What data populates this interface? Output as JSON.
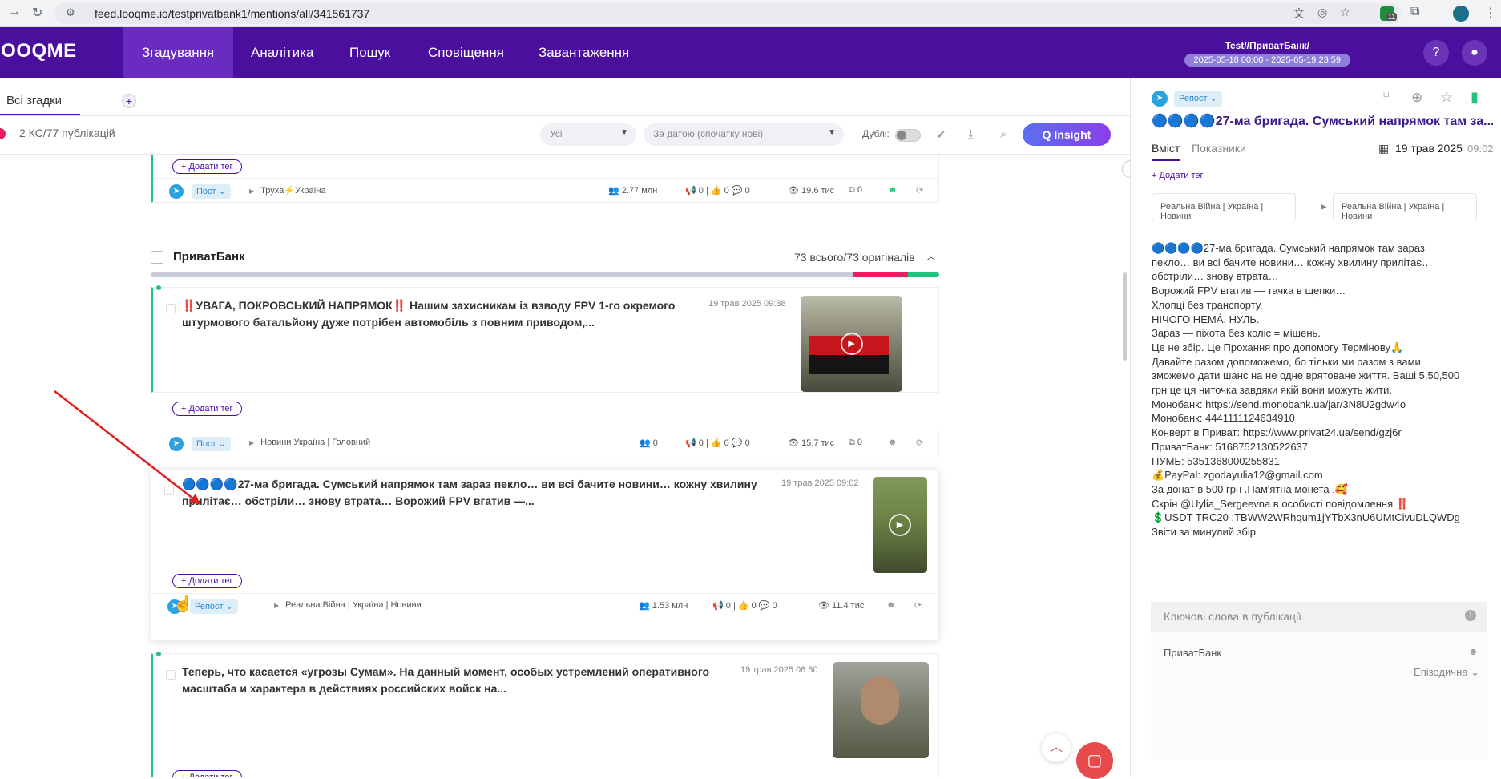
{
  "browser": {
    "url": "feed.looqme.io/testprivatbank1/mentions/all/341561737",
    "badge_count": "11"
  },
  "header": {
    "logo": "LOOQME",
    "nav": [
      "Згадування",
      "Аналітика",
      "Пошук",
      "Сповіщення",
      "Завантаження"
    ],
    "user_name": "Test//ПриватБанк/",
    "date_range": "2025-05-18 00:00 - 2025-05-19 23:59",
    "help_label": "?"
  },
  "tabs": {
    "all_label": "Всі згадки",
    "add_label": "+"
  },
  "filters": {
    "count_text": "2 КС/77 публікацій",
    "type_select": "Усі",
    "sort_select": "За датою (спочатку нові)",
    "duplicates_label": "Дублі:",
    "insight_label": "Q Insight"
  },
  "feed": {
    "add_tag_label": "+ Додати тег",
    "top_card": {
      "type": "Пост",
      "source": "Труха⚡Україна",
      "audience": "2.77 млн",
      "reposts": "0",
      "likes": "0",
      "comments": "0",
      "views": "19.6 тис",
      "copies": "0"
    },
    "group": {
      "title": "ПриватБанк",
      "count": "73 всього/73 оригіналів",
      "sentiment_bar": {
        "neutral": 0.89,
        "negative": 0.07,
        "positive": 0.04
      }
    },
    "posts": [
      {
        "title_line1": "‼️УВАГА, ПОКРОВСЬКИЙ НАПРЯМОК‼️ Нашим захисникам із взводу FPV 1-го окремого",
        "title_line2": "штурмового батальйону дуже потрібен автомобіль з повним приводом,...",
        "date": "19 трав 2025 09:38",
        "type": "Пост",
        "source": "Новини Україна | Головний",
        "audience": "0",
        "reposts": "0",
        "likes": "0",
        "comments": "0",
        "views": "15.7 тис",
        "copies": "0"
      },
      {
        "title_line1": "🔵🔵🔵🔵27-ма бригада. Сумський напрямок там зараз пекло… ви всі бачите новини… кожну хвилину",
        "title_line2": "прилітає… обстріли… знову втрата… Ворожий FPV вгатив —...",
        "date": "19 трав 2025 09:02",
        "type": "Репост",
        "source": "Реальна Війна | Україна | Новини",
        "audience": "1.53 млн",
        "reposts": "0",
        "likes": "0",
        "comments": "0",
        "views": "11.4 тис"
      },
      {
        "title_line1": "Теперь, что касается «угрозы Сумам». На данный момент, особых устремлений оперативного",
        "title_line2": "масштаба и характера в действиях российских войск на...",
        "date": "19 трав 2025 08:50"
      }
    ]
  },
  "panel": {
    "type_chip": "Репост",
    "title": "🔵🔵🔵🔵27-ма бригада. Сумський напрямок там за...",
    "tab_content": "Вміст",
    "tab_metrics": "Показники",
    "date": "19 трав 2025",
    "time": "09:02",
    "add_tag": "+ Додати тег",
    "source_from": "Реальна Війна | Україна | Новини",
    "source_to": "Реальна Війна | Україна | Новини",
    "content_lines": [
      "🔵🔵🔵🔵27-ма бригада. Сумський напрямок там зараз",
      "пекло… ви всі бачите новини… кожну хвилину прилітає…",
      "обстріли… знову втрата…",
      "Ворожий FPV вгатив — тачка в щепки…",
      "Хлопці без транспорту.",
      "НІЧОГО НЕМА́. НУЛЬ.",
      "Зараз — піхота без коліс = мішень.",
      "Це не збір. Це Прохання про допомогу Термінову🙏",
      "Давайте разом допоможемо, бо тільки ми разом з вами",
      "зможемо дати шанс на не одне врятоване життя. Ваші 5,50,500",
      "грн це ця ниточка завдяки якій вони можуть жити.",
      "Монобанк: https://send.monobank.ua/jar/3N8U2gdw4o",
      "Монобанк: 4441111124634910",
      "Конверт в Приват: https://www.privat24.ua/send/gzj6r",
      "ПриватБанк: 5168752130522637",
      "ПУМБ: 5351368000255831",
      "💰PayPal: zgodayulia12@gmail.com",
      "За донат в 500 грн .Пам'ятна монета .🥰",
      "Скрін @Uylia_Sergeevna в особисті повідомлення ‼️",
      "💲USDT TRC20 :TBWW2WRhqum1jYTbX3nU6UMtCivuDLQWDg",
      "Звіти за минулий збір"
    ],
    "keywords_header": "Ключові слова в публікації",
    "keyword": "ПриватБанк",
    "keyword_kind": "Епізодична"
  },
  "colors": {
    "brand": "#4b0f9d",
    "positive": "#1ec37c",
    "negative": "#e91e63",
    "neutral": "#c7ccd6"
  }
}
